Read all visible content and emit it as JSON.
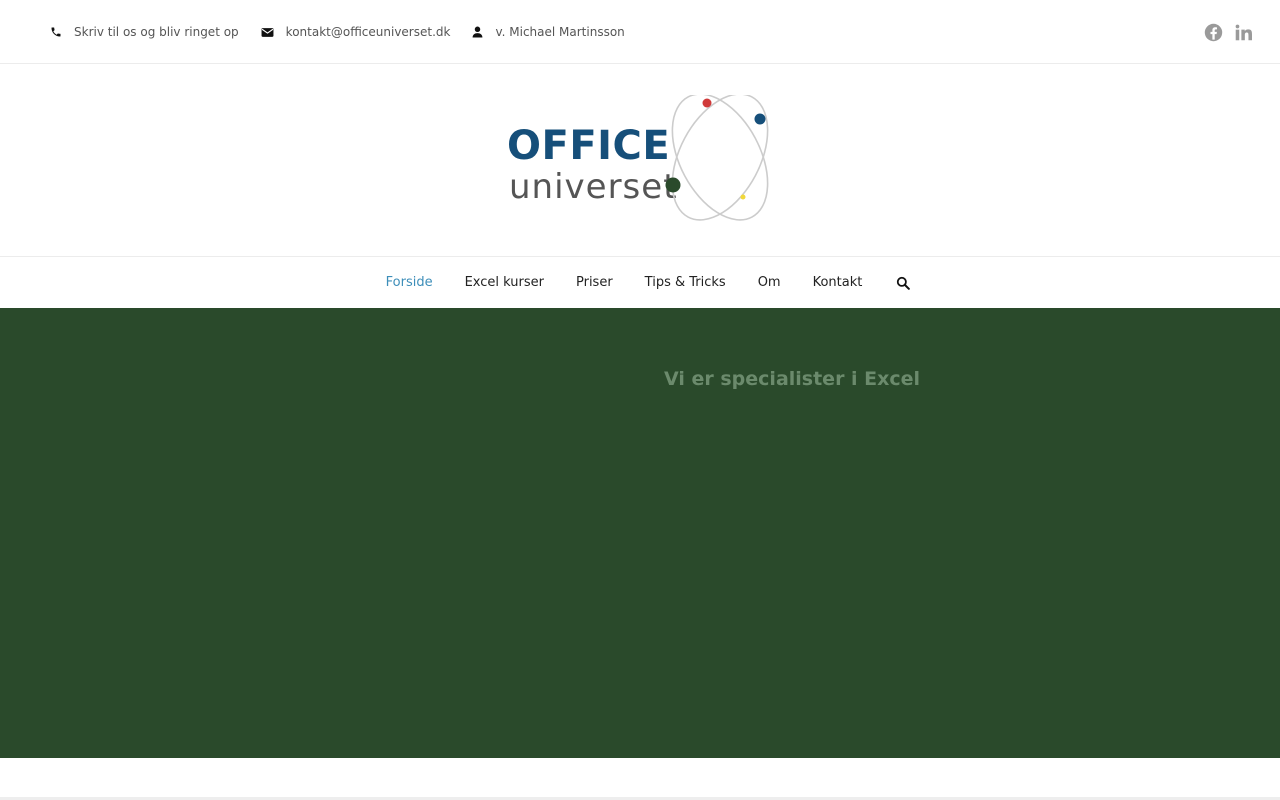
{
  "topbar": {
    "items": [
      {
        "icon": "phone-icon",
        "label": "Skriv til os og bliv ringet op"
      },
      {
        "icon": "envelope-icon",
        "label": "kontakt@officeuniverset.dk"
      },
      {
        "icon": "user-icon",
        "label": "v. Michael Martinsson"
      }
    ],
    "social": [
      "facebook-icon",
      "linkedin-icon"
    ]
  },
  "logo": {
    "line1": "OFFICE",
    "line2": "universet",
    "colors": {
      "primary": "#164f7a",
      "secondary": "#555555"
    }
  },
  "nav": {
    "items": [
      "Forside",
      "Excel kurser",
      "Priser",
      "Tips & Tricks",
      "Om",
      "Kontakt"
    ],
    "active": "Forside",
    "active_color": "#3d8eb9"
  },
  "hero": {
    "heading": "Vi er specialister i Excel",
    "background": "#2a4a2b"
  }
}
